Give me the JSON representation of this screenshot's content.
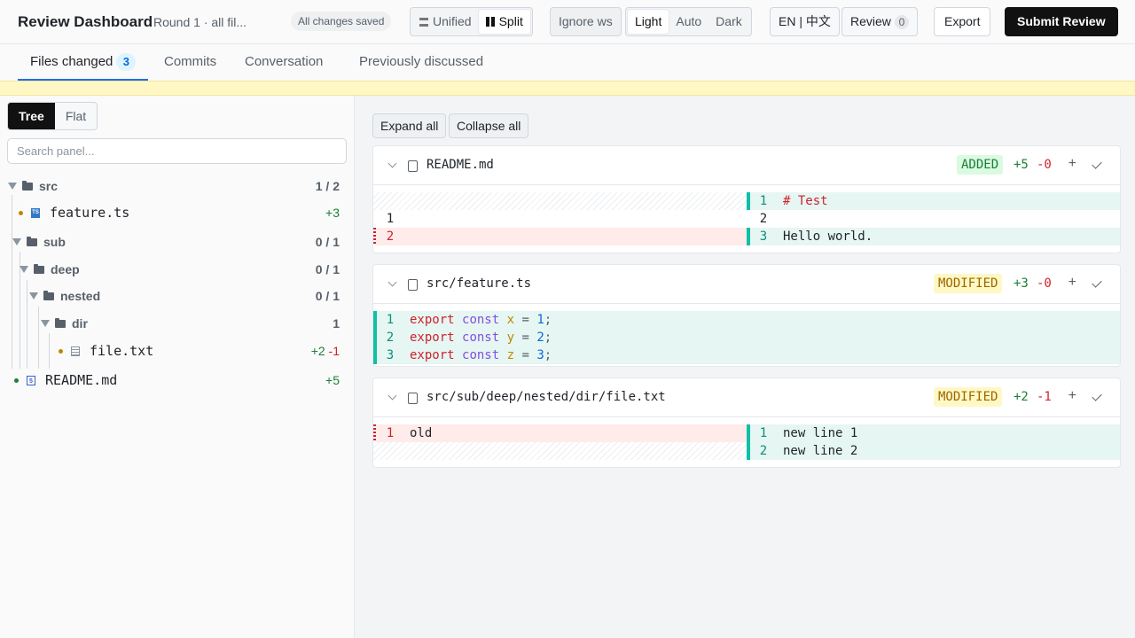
{
  "header": {
    "title": "Review Dashboard",
    "round": "Round 1 · all fil...",
    "saved": "All changes saved",
    "view_modes": [
      "Unified",
      "Split"
    ],
    "ignore_ws": "Ignore ws",
    "themes": [
      "Light",
      "Auto",
      "Dark"
    ],
    "lang": "EN | 中文",
    "review_label": "Review",
    "review_count": "0",
    "export": "Export",
    "submit": "Submit Review"
  },
  "tabs": {
    "files_changed": "Files changed",
    "files_count": "3",
    "commits": "Commits",
    "conversation": "Conversation",
    "previously": "Previously discussed"
  },
  "sidebar": {
    "tree": "Tree",
    "flat": "Flat",
    "search_placeholder": "Search panel...",
    "items": [
      {
        "label": "src",
        "stat": "1 / 2"
      },
      {
        "label": "feature.ts",
        "stat": "+3"
      },
      {
        "label": "sub",
        "stat": "0 / 1"
      },
      {
        "label": "deep",
        "stat": "0 / 1"
      },
      {
        "label": "nested",
        "stat": "0 / 1"
      },
      {
        "label": "dir",
        "stat": "1"
      },
      {
        "label": "file.txt",
        "stat_add": "+2",
        "stat_del": "-1"
      },
      {
        "label": "README.md",
        "stat": "+5"
      }
    ]
  },
  "main": {
    "expand_all": "Expand all",
    "collapse_all": "Collapse all",
    "files": [
      {
        "name": "README.md",
        "status": "ADDED",
        "add": "+5",
        "del": "-0",
        "lines": [
          {
            "right_no": "1",
            "right": "# Test"
          },
          {
            "left_no": "1",
            "right_no": "2"
          },
          {
            "left_no": "2",
            "right_no": "3",
            "right": "Hello world."
          }
        ]
      },
      {
        "name": "src/feature.ts",
        "status": "MODIFIED",
        "add": "+3",
        "del": "-0",
        "lines": [
          {
            "no": "1",
            "kw": "export",
            "kw2": "const",
            "var": "x",
            "eq": "=",
            "num": "1",
            "end": ";"
          },
          {
            "no": "2",
            "kw": "export",
            "kw2": "const",
            "var": "y",
            "eq": "=",
            "num": "2",
            "end": ";"
          },
          {
            "no": "3",
            "kw": "export",
            "kw2": "const",
            "var": "z",
            "eq": "=",
            "num": "3",
            "end": ";"
          }
        ]
      },
      {
        "name": "src/sub/deep/nested/dir/file.txt",
        "status": "MODIFIED",
        "add": "+2",
        "del": "-1",
        "lines": [
          {
            "left_no": "1",
            "left": "old",
            "right_no": "1",
            "right": "new line 1"
          },
          {
            "right_no": "2",
            "right": "new line 2"
          }
        ]
      }
    ]
  },
  "colors": {
    "accent": "#1f6feb",
    "added": "#1a7f37",
    "deleted": "#cf222e",
    "modified": "#9a6700"
  }
}
